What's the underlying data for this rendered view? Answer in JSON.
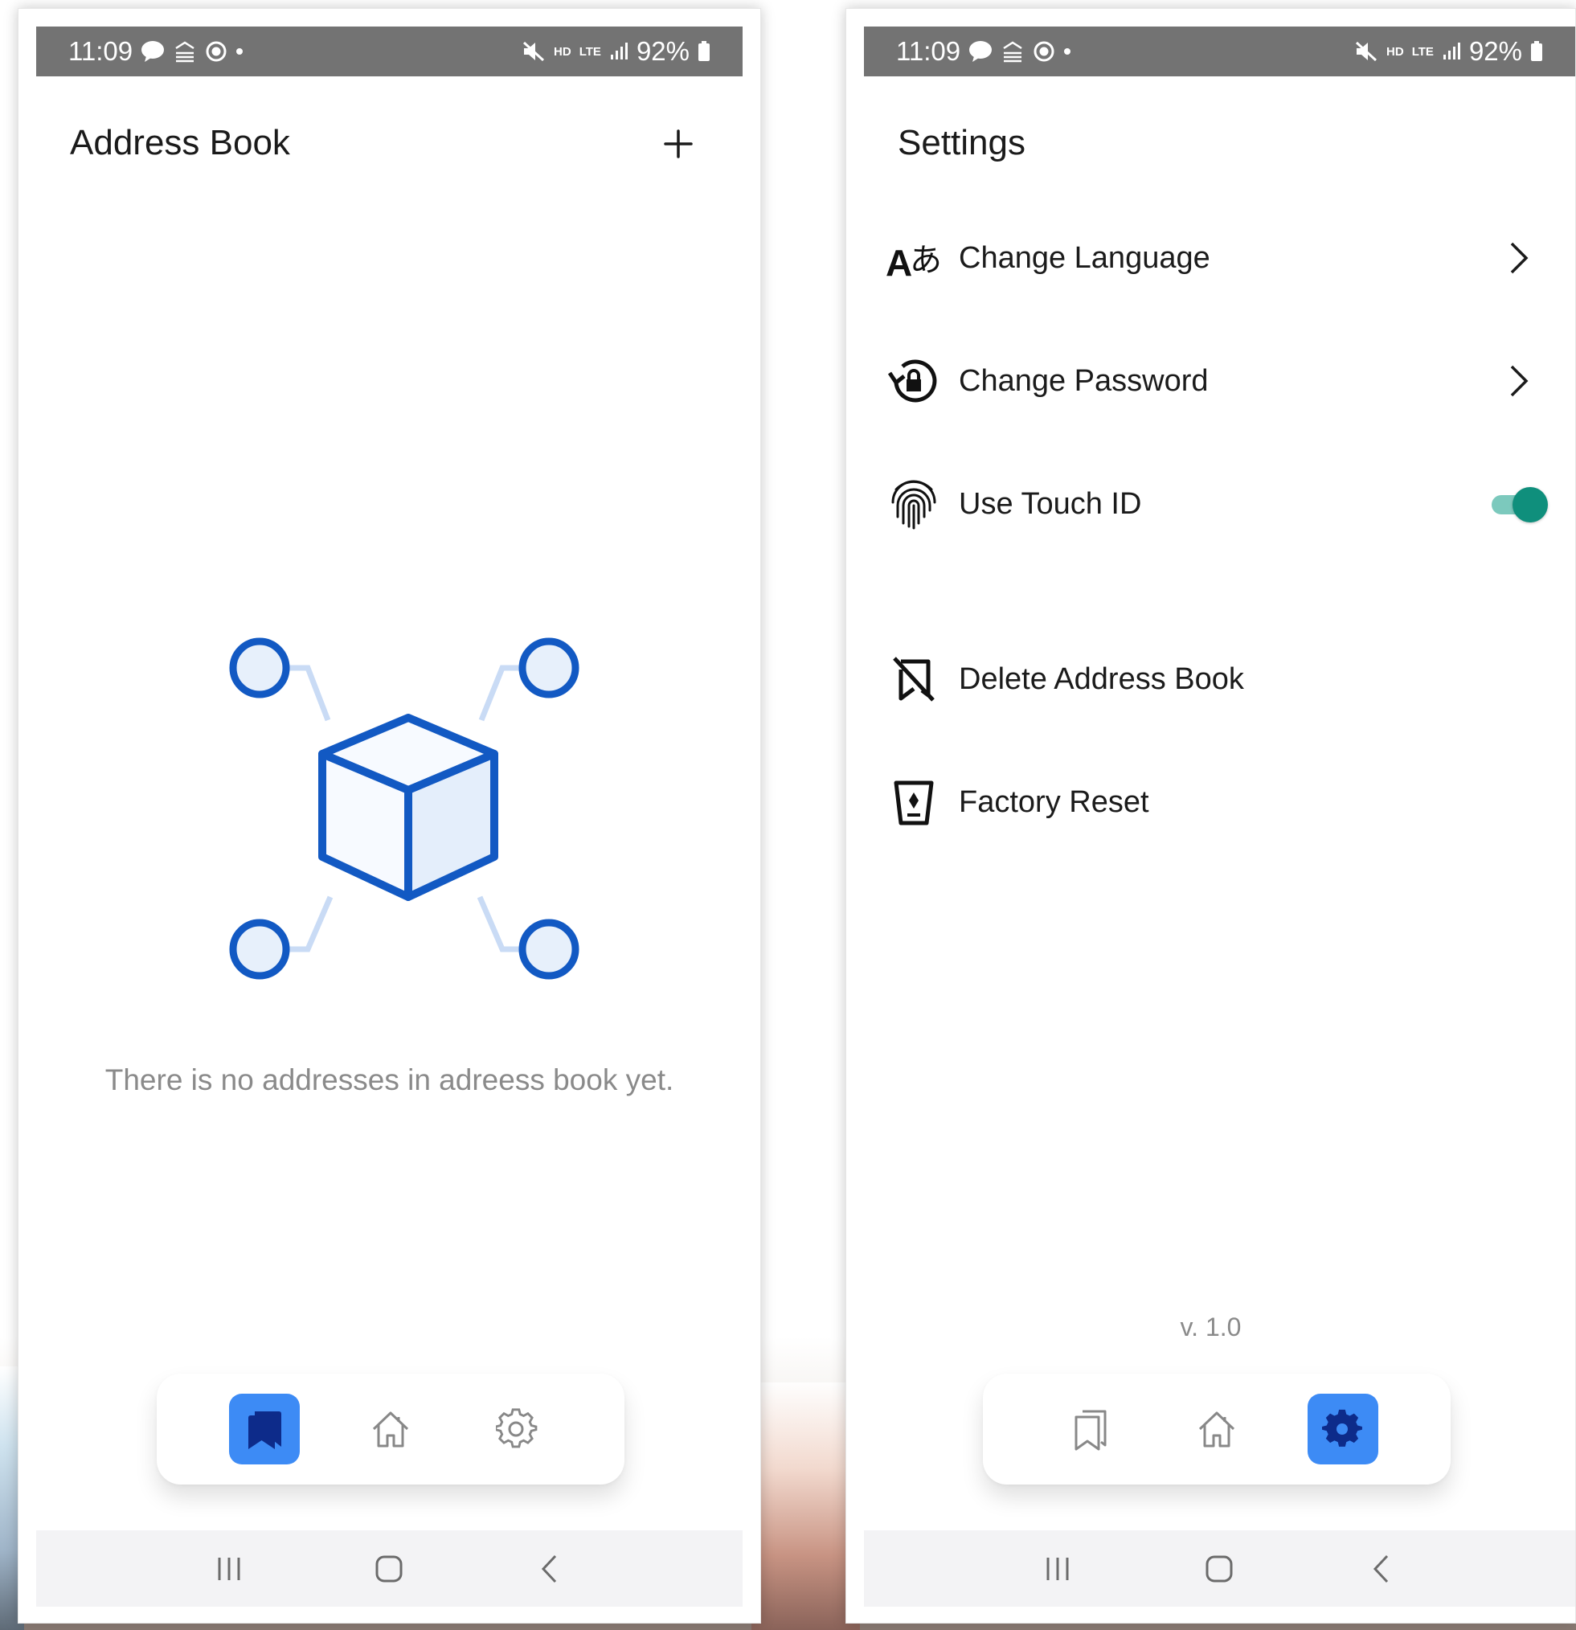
{
  "status_bar": {
    "time": "11:09",
    "hd_label": "HD",
    "lte_label": "LTE",
    "battery": "92%"
  },
  "address_book_screen": {
    "title": "Address Book",
    "empty_message": "There is no addresses in adreess book yet.",
    "tabs": [
      {
        "name": "address-book",
        "icon": "bookmark-icon",
        "active": true
      },
      {
        "name": "home",
        "icon": "home-icon",
        "active": false
      },
      {
        "name": "settings",
        "icon": "gear-icon",
        "active": false
      }
    ]
  },
  "settings_screen": {
    "title": "Settings",
    "items": [
      {
        "label": "Change Language",
        "icon": "translate-icon",
        "trailing": "chevron-right-icon"
      },
      {
        "label": "Change Password",
        "icon": "lock-reset-icon",
        "trailing": "chevron-right-icon"
      },
      {
        "label": "Use Touch ID",
        "icon": "fingerprint-icon",
        "trailing": "toggle",
        "enabled": true
      },
      {
        "label": "Delete Address Book",
        "icon": "bookmark-off-icon",
        "trailing": null
      },
      {
        "label": "Factory Reset",
        "icon": "bin-reset-icon",
        "trailing": null
      }
    ],
    "version": "v. 1.0",
    "tabs": [
      {
        "name": "address-book",
        "icon": "bookmark-outline-icon",
        "active": false
      },
      {
        "name": "home",
        "icon": "home-icon",
        "active": false
      },
      {
        "name": "settings",
        "icon": "gear-icon",
        "active": true
      }
    ]
  },
  "colors": {
    "status_bar": "#737373",
    "accent_blue": "#3d8bf5",
    "illustration_blue": "#1259c3",
    "toggle_on": "#0f8f7c"
  }
}
